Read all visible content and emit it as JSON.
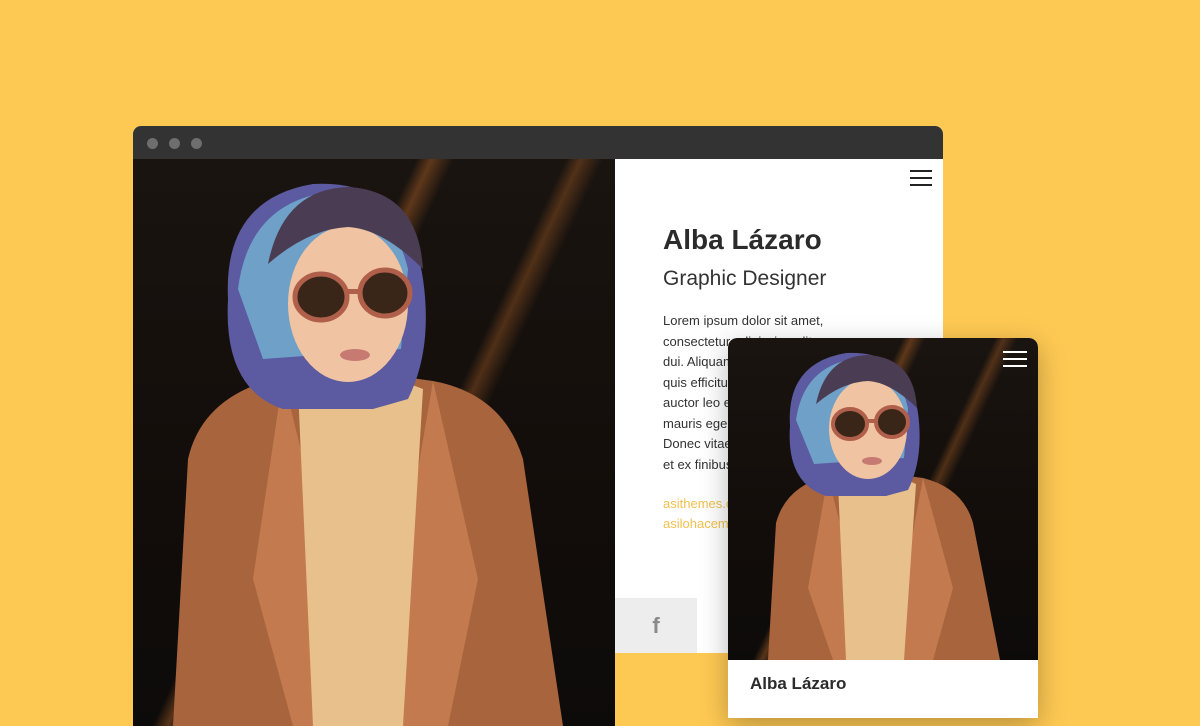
{
  "profile": {
    "name": "Alba Lázaro",
    "title": "Graphic Designer",
    "bio_lines": [
      "Lorem ipsum dolor sit amet,",
      "consectetur adipiscing elit.",
      "dui. Aliquam",
      "quis efficitur",
      "auctor leo e",
      "mauris ege",
      "Donec vitae",
      "et ex finibus"
    ],
    "links": [
      "asithemes.c",
      "asilohacem"
    ]
  },
  "social": {
    "facebook_glyph": "f"
  },
  "icons": {
    "menu": "hamburger-menu-icon",
    "social": "facebook-icon"
  },
  "colors": {
    "background": "#fec953",
    "accent_link": "#f2c14e",
    "chrome": "#333333"
  }
}
